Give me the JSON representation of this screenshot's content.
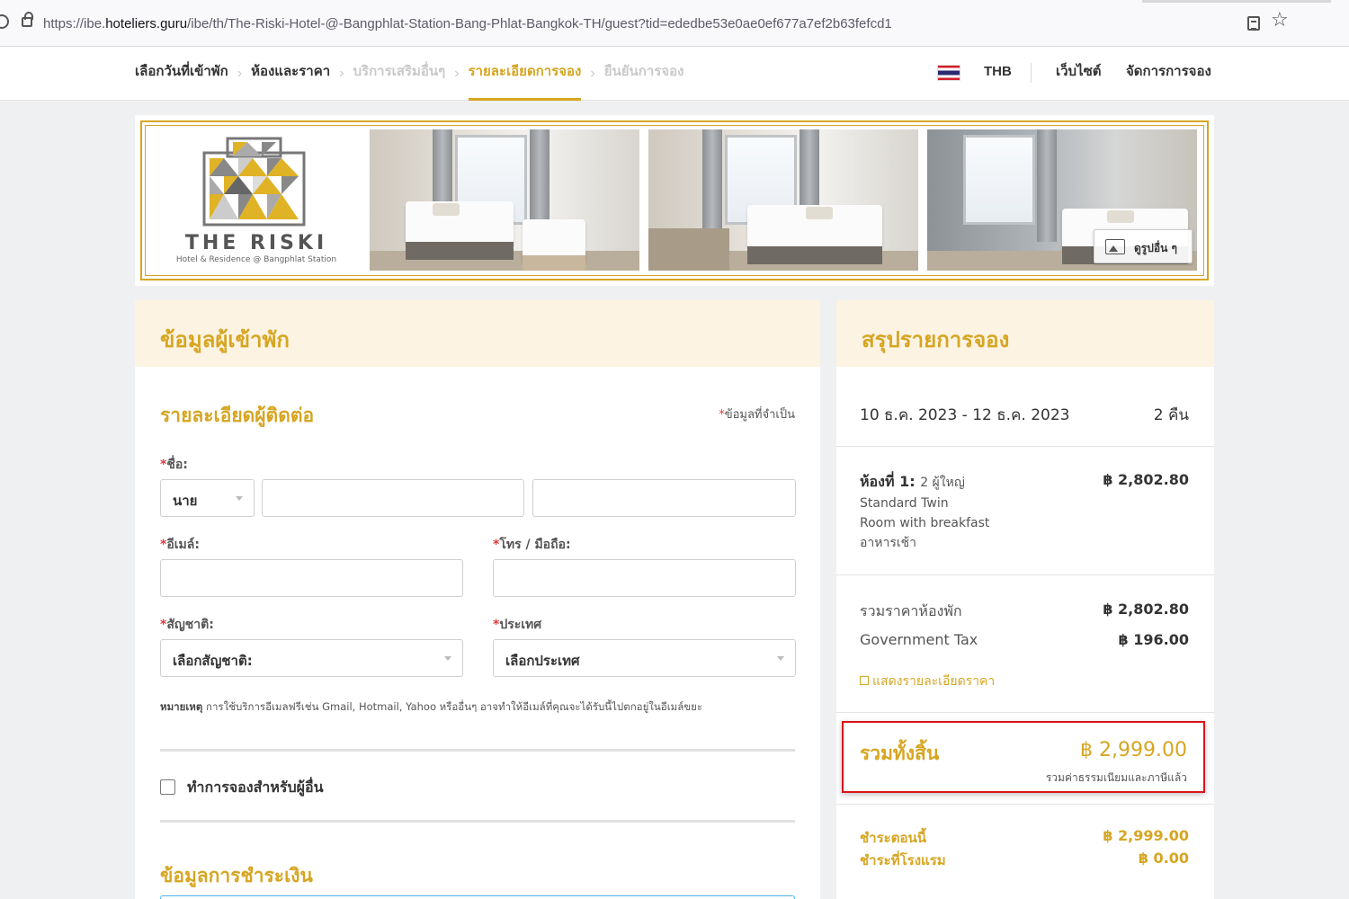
{
  "browser": {
    "url_prefix": "https://ibe.",
    "url_host": "hoteliers.guru",
    "url_path": "/ibe/th/The-Riski-Hotel-@-Bangphlat-Station-Bang-Phlat-Bangkok-TH/guest?tid=ededbe53e0ae0ef677a7ef2b63fefcd1"
  },
  "nav": {
    "steps": [
      {
        "label": "เลือกวันที่เข้าพัก"
      },
      {
        "label": "ห้องและราคา"
      },
      {
        "label": "บริการเสริมอื่นๆ"
      },
      {
        "label": "รายละเอียดการจอง"
      },
      {
        "label": "ยืนยันการจอง"
      }
    ],
    "currency": "THB",
    "website": "เว็บไซต์",
    "manage": "จัดการการจอง",
    "colors": {
      "accent": "#d6a521",
      "disabled": "#c9c9c9"
    }
  },
  "banner": {
    "logo_name": "THE RISKI",
    "logo_sub": "Hotel & Residence @ Bangphlat Station",
    "more_photos": "ดูรูปอื่น ๆ"
  },
  "guest": {
    "header": "ข้อมูลผู้เข้าพัก",
    "contact_title": "รายละเอียดผู้ติดต่อ",
    "required_note": "ข้อมูลที่จำเป็น",
    "name_label": "ชื่อ:",
    "title_value": "นาย",
    "email_label": "อีเมล์:",
    "phone_label": "โทร / มือถือ:",
    "nationality_label": "สัญชาติ:",
    "nationality_value": "เลือกสัญชาติ:",
    "country_label": "ประเทศ",
    "country_value": "เลือกประเทศ",
    "note_bold": "หมายเหตุ",
    "note_text": "การใช้บริการอีเมลฟรีเช่น Gmail, Hotmail, Yahoo หรืออื่นๆ อาจทำให้อีเมล์ที่คุณจะได้รับนี้ไปตกอยู่ในอีเมล์ขยะ",
    "book_for_other": "ทำการจองสำหรับผู้อื่น",
    "payment_title": "ข้อมูลการชำระเงิน"
  },
  "summary": {
    "header": "สรุปรายการจอง",
    "dates": "10 ธ.ค. 2023 - 12 ธ.ค. 2023",
    "nights": "2 คืน",
    "room_title": "ห้องที่ 1:",
    "room_guests": "2 ผู้ใหญ่",
    "room_type_1": "Standard Twin",
    "room_type_2": "Room with breakfast",
    "room_meal": "อาหารเช้า",
    "room_price": "฿ 2,802.80",
    "subtotal_label": "รวมราคาห้องพัก",
    "subtotal_value": "฿ 2,802.80",
    "tax_label": "Government Tax",
    "tax_value": "฿ 196.00",
    "detail_link": "แสดงรายละเอียดราคา",
    "total_label": "รวมทั้งสิ้น",
    "total_value": "฿ 2,999.00",
    "total_sub": "รวมค่าธรรมเนียมและภาษีแล้ว",
    "pay_now_label": "ชำระตอนนี้",
    "pay_now_value": "฿ 2,999.00",
    "pay_hotel_label": "ชำระที่โรงแรม",
    "pay_hotel_value": "฿ 0.00"
  }
}
